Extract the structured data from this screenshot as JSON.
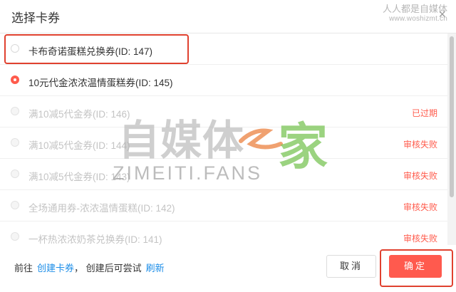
{
  "dialog": {
    "title": "选择卡券",
    "close_label": "×"
  },
  "watermark": {
    "top_line1": "人人都是自媒体",
    "top_line2": "www.woshizmt.cn",
    "logo_main": "自媒体",
    "logo_connector": "之",
    "logo_accent": "家",
    "logo_sub": "ZIMEITI.FANS"
  },
  "coupons": [
    {
      "label": "卡布奇诺蛋糕兑换券(ID: 147)",
      "status": "",
      "selected": false,
      "disabled": false
    },
    {
      "label": "10元代金浓浓温情蛋糕券(ID: 145)",
      "status": "",
      "selected": true,
      "disabled": false
    },
    {
      "label": "满10减5代金券(ID: 146)",
      "status": "已过期",
      "selected": false,
      "disabled": true
    },
    {
      "label": "满10减5代金券(ID: 144)",
      "status": "审核失败",
      "selected": false,
      "disabled": true
    },
    {
      "label": "满10减5代金券(ID: 143)",
      "status": "审核失败",
      "selected": false,
      "disabled": true
    },
    {
      "label": "全场通用券-浓浓温情蛋糕(ID: 142)",
      "status": "审核失败",
      "selected": false,
      "disabled": true
    },
    {
      "label": "一杯热浓浓奶茶兑换券(ID: 141)",
      "status": "审核失败",
      "selected": false,
      "disabled": true
    }
  ],
  "footer": {
    "prefix": "前往",
    "create_link": "创建卡券",
    "middle": "，  创建后可尝试",
    "refresh_link": "刷新",
    "cancel_label": "取消",
    "ok_label": "确定"
  },
  "colors": {
    "accent": "#ff5a4e",
    "link": "#1d8ee8",
    "status_text": "#ff5b4c",
    "highlight_frame": "#e0412f"
  }
}
